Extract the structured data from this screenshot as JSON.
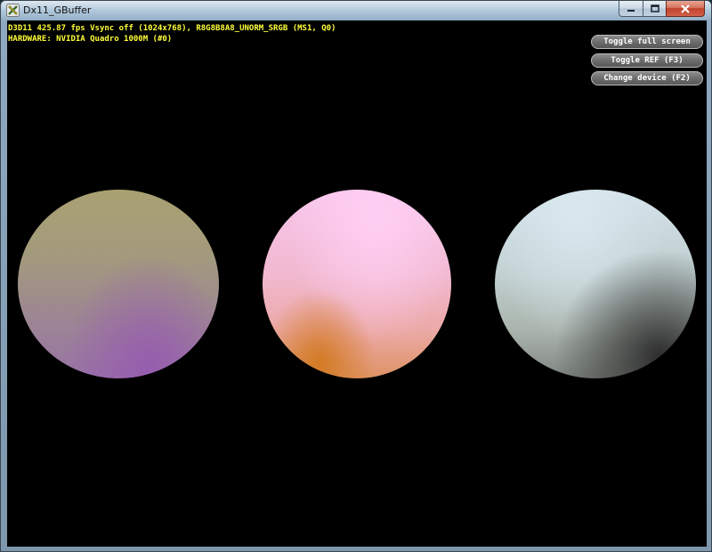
{
  "window": {
    "title": "Dx11_GBuffer"
  },
  "hud": {
    "stats_line": "D3D11 425.87 fps Vsync off (1024x768), R8G8B8A8_UNORM_SRGB (MS1, Q0)",
    "hardware_line": "HARDWARE: NVIDIA Quadro 1000M  (#0)",
    "text_color": "#ffff3a"
  },
  "buttons": {
    "toggle_full_screen": "Toggle full screen",
    "toggle_ref": "Toggle REF (F3)",
    "change_device": "Change device (F2)"
  },
  "icons": {
    "app": "dx-app-icon",
    "minimize": "minimize-icon",
    "maximize": "maximize-icon",
    "close": "close-icon"
  },
  "scene": {
    "background": "#000000",
    "spheres": [
      {
        "name": "left-sphere",
        "colors": [
          "#a9a172",
          "#9873a6"
        ]
      },
      {
        "name": "middle-sphere",
        "colors": [
          "#f8c6eb",
          "#de9364"
        ]
      },
      {
        "name": "right-sphere",
        "colors": [
          "#d1e1e8",
          "#3a3a3a"
        ]
      }
    ]
  }
}
